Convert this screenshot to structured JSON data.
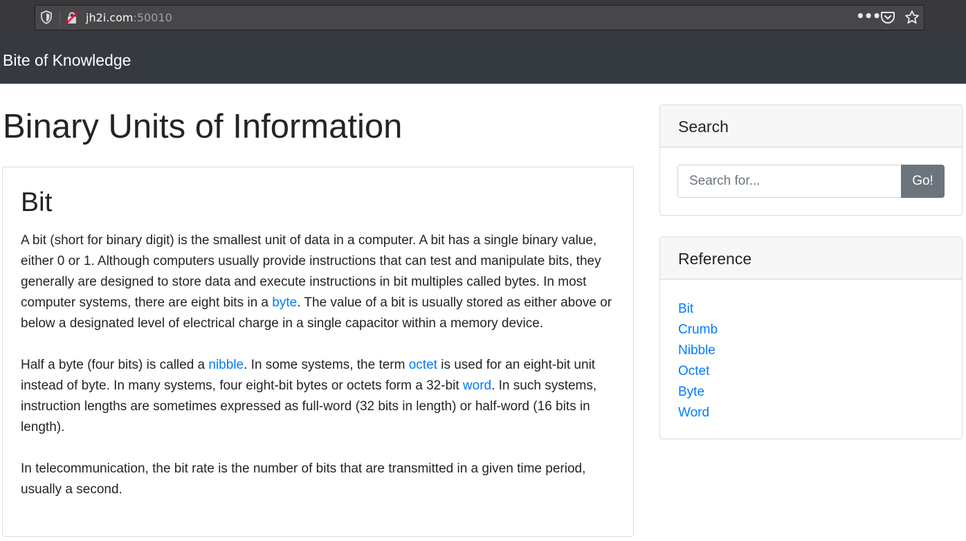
{
  "browser": {
    "url_host": "jh2i.com",
    "url_port": ":50010",
    "icons": [
      "shield-icon",
      "insecure-connection-icon",
      "more-actions-icon",
      "pocket-icon",
      "bookmark-star-icon"
    ]
  },
  "navbar": {
    "brand": "Bite of Knowledge"
  },
  "main": {
    "title": "Binary Units of Information",
    "post": {
      "heading": "Bit",
      "p1": {
        "t1": "A bit (short for binary digit) is the smallest unit of data in a computer. A bit has a single binary value, either 0 or 1. Although computers usually provide instructions that can test and manipulate bits, they generally are designed to store data and execute instructions in bit multiples called bytes. In most computer systems, there are eight bits in a ",
        "link_byte": "byte",
        "t2": ". The value of a bit is usually stored as either above or below a designated level of electrical charge in a single capacitor within a memory device."
      },
      "p2": {
        "t1": "Half a byte (four bits) is called a ",
        "link_nibble": "nibble",
        "t2": ". In some systems, the term ",
        "link_octet": "octet",
        "t3": " is used for an eight-bit unit instead of byte. In many systems, four eight-bit bytes or octets form a 32-bit ",
        "link_word": "word",
        "t4": ". In such systems, instruction lengths are sometimes expressed as full-word (32 bits in length) or half-word (16 bits in length)."
      },
      "p3": "In telecommunication, the bit rate is the number of bits that are transmitted in a given time period, usually a second."
    }
  },
  "sidebar": {
    "search": {
      "header": "Search",
      "placeholder": "Search for...",
      "value": "",
      "button": "Go!"
    },
    "reference": {
      "header": "Reference",
      "items": [
        "Bit",
        "Crumb",
        "Nibble",
        "Octet",
        "Byte",
        "Word"
      ]
    }
  },
  "colors": {
    "navbar_bg": "#343a40",
    "link": "#007bff",
    "button_bg": "#6c757d",
    "browser_bg": "#38383d"
  }
}
